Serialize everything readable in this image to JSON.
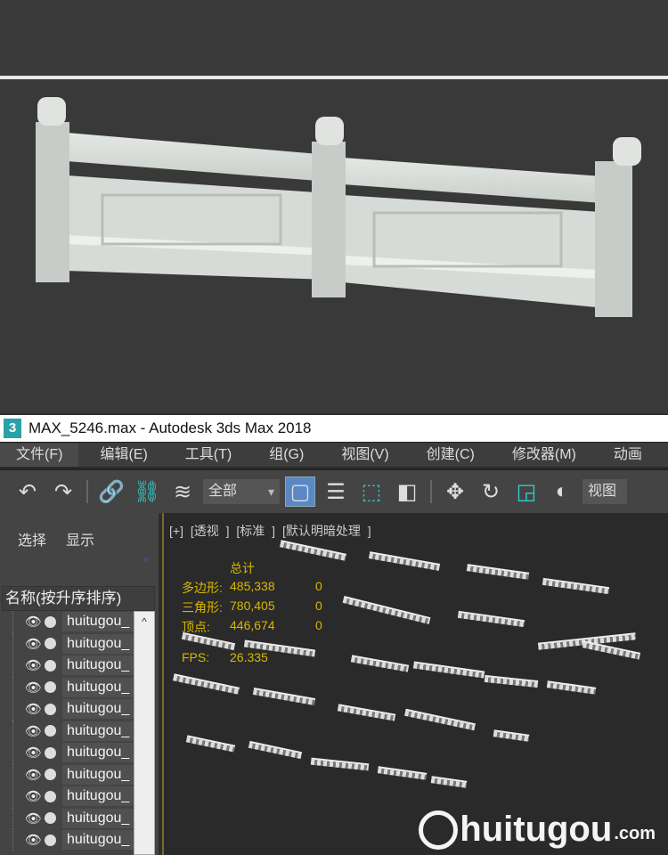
{
  "window": {
    "title": "MAX_5246.max - Autodesk 3ds Max 2018",
    "app_icon": "3"
  },
  "menu": [
    "文件(F)",
    "编辑(E)",
    "工具(T)",
    "组(G)",
    "视图(V)",
    "创建(C)",
    "修改器(M)",
    "动画"
  ],
  "toolbar": {
    "selection_filter": "全部",
    "ref_coord": "视图"
  },
  "scene_explorer": {
    "tabs": [
      "选择",
      "显示"
    ],
    "expand": "»",
    "column_header": "名称(按升序排序)",
    "items": [
      "huitugou_",
      "huitugou_",
      "huitugou_",
      "huitugou_",
      "huitugou_",
      "huitugou_",
      "huitugou_",
      "huitugou_",
      "huitugou_",
      "huitugou_",
      "huitugou_"
    ],
    "scroll_up": "^"
  },
  "viewport": {
    "labels": "[+]  [透视 ]  [标准 ]  [默认明暗处理 ]",
    "stats": {
      "header": "总计",
      "rows": [
        {
          "k": "多边形:",
          "v": "485,338",
          "s": "0"
        },
        {
          "k": "三角形:",
          "v": "780,405",
          "s": "0"
        },
        {
          "k": "顶点:",
          "v": "446,674",
          "s": "0"
        }
      ],
      "fps_label": "FPS:",
      "fps": "26.335"
    }
  },
  "watermark": {
    "text": "huitugou",
    "suffix": ".com"
  }
}
